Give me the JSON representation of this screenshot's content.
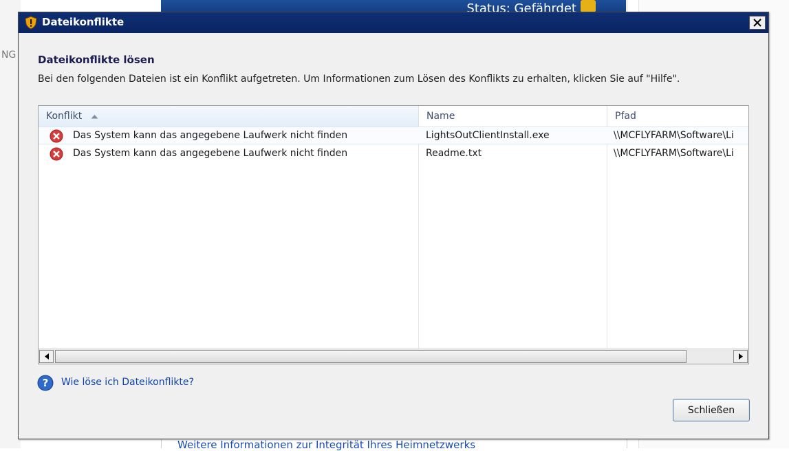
{
  "background": {
    "left_fragment": "NG",
    "status_text": "Status: Gefährdet",
    "bottom_link": "Weitere Informationen zur Integrität Ihres Heimnetzwerks"
  },
  "dialog": {
    "title": "Dateikonflikte",
    "heading": "Dateikonflikte lösen",
    "description": "Bei den folgenden Dateien ist ein Konflikt aufgetreten. Um Informationen zum Lösen des Konflikts zu erhalten, klicken Sie auf \"Hilfe\".",
    "columns": [
      {
        "label": "Konflikt"
      },
      {
        "label": "Name"
      },
      {
        "label": "Pfad"
      }
    ],
    "rows": [
      {
        "conflict": "Das System kann das angegebene Laufwerk nicht finden",
        "name": "LightsOutClientInstall.exe",
        "path": "\\\\MCFLYFARM\\Software\\Li"
      },
      {
        "conflict": "Das System kann das angegebene Laufwerk nicht finden",
        "name": "Readme.txt",
        "path": "\\\\MCFLYFARM\\Software\\Li"
      }
    ],
    "help_link": "Wie löse ich Dateikonflikte?",
    "close_button_label": "Schließen"
  },
  "icons": {
    "title": "security-shield-icon",
    "error": "error-x-icon",
    "help": "help-question-icon",
    "sort": "sort-ascending-icon",
    "close": "close-x-icon"
  },
  "colors": {
    "titlebar": "#0f2f73",
    "link": "#0c43a9",
    "error": "#d83b3b"
  }
}
